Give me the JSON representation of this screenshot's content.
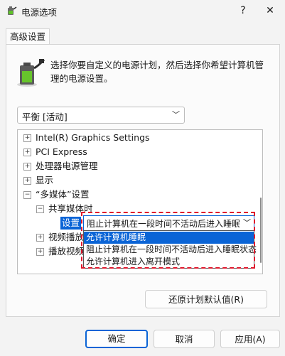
{
  "window": {
    "title": "电源选项",
    "help_glyph": "?",
    "close_glyph": "✕"
  },
  "tabs": [
    {
      "label": "高级设置"
    }
  ],
  "description": "选择你要自定义的电源计划，然后选择你希望计算机管理的电源设置。",
  "plan_select": {
    "value": "平衡 [活动]"
  },
  "tree": {
    "items": [
      {
        "expander": "+",
        "label": "Intel(R) Graphics Settings"
      },
      {
        "expander": "+",
        "label": "PCI Express"
      },
      {
        "expander": "+",
        "label": "处理器电源管理"
      },
      {
        "expander": "+",
        "label": "显示"
      },
      {
        "expander": "−",
        "label": "“多媒体”设置"
      },
      {
        "expander": "−",
        "label": "共享媒体时"
      },
      {
        "expander": "",
        "label": "设置"
      },
      {
        "expander": "+",
        "label": "视频播放"
      },
      {
        "expander": "+",
        "label": "播放视频"
      }
    ]
  },
  "setting_combo": {
    "value": "阻止计算机在一段时间不活动后进入睡眠状态",
    "options": [
      "允许计算机睡眠",
      "阻止计算机在一段时间不活动后进入睡眠状态",
      "允许计算机进入离开模式"
    ],
    "highlighted_index": 0
  },
  "buttons": {
    "restore_defaults": "还原计划默认值(R)",
    "ok": "确定",
    "cancel": "取消",
    "apply": "应用(A)"
  },
  "colors": {
    "accent": "#0a64d6",
    "highlight_box": "#e0192d"
  }
}
